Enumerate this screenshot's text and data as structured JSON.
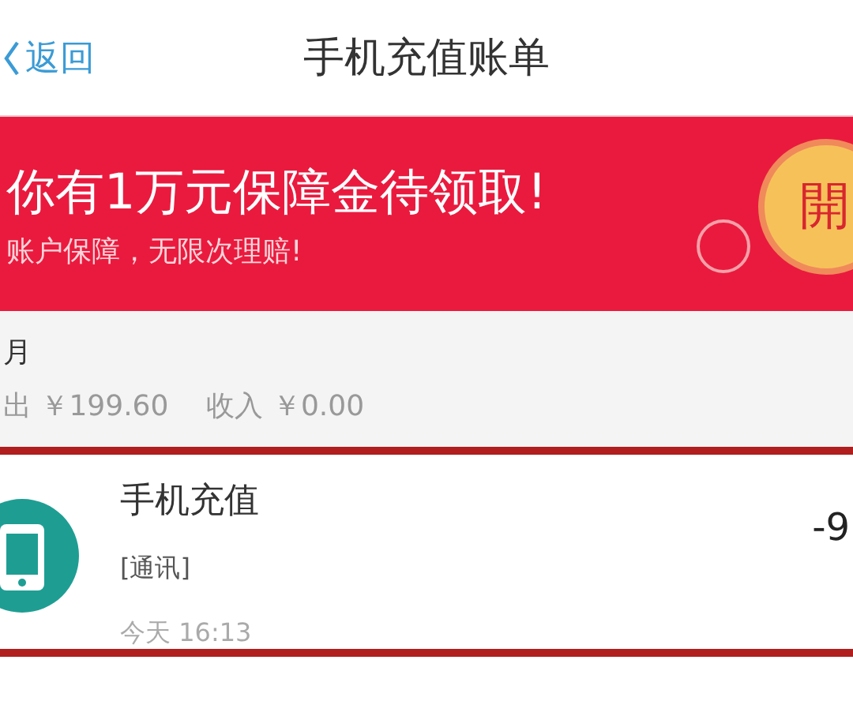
{
  "nav": {
    "back": "返回",
    "title": "手机充值账单"
  },
  "banner": {
    "headline": "你有1万元保障金待领取!",
    "subline": "账户保障，无限次理赔!",
    "badge": "開"
  },
  "month": {
    "label": "月",
    "expense": "出 ￥199.60",
    "income": "收入 ￥0.00"
  },
  "records": [
    {
      "title": "手机充值",
      "category": "[通讯]",
      "time": "今天  16:13",
      "amount": "-9"
    }
  ]
}
